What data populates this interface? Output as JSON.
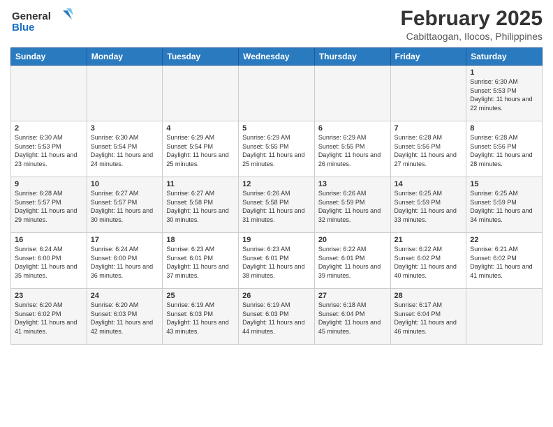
{
  "header": {
    "logo_line1": "General",
    "logo_line2": "Blue",
    "title": "February 2025",
    "subtitle": "Cabittaogan, Ilocos, Philippines"
  },
  "days_of_week": [
    "Sunday",
    "Monday",
    "Tuesday",
    "Wednesday",
    "Thursday",
    "Friday",
    "Saturday"
  ],
  "weeks": [
    [
      {
        "day": "",
        "info": ""
      },
      {
        "day": "",
        "info": ""
      },
      {
        "day": "",
        "info": ""
      },
      {
        "day": "",
        "info": ""
      },
      {
        "day": "",
        "info": ""
      },
      {
        "day": "",
        "info": ""
      },
      {
        "day": "1",
        "info": "Sunrise: 6:30 AM\nSunset: 5:53 PM\nDaylight: 11 hours and 22 minutes."
      }
    ],
    [
      {
        "day": "2",
        "info": "Sunrise: 6:30 AM\nSunset: 5:53 PM\nDaylight: 11 hours and 23 minutes."
      },
      {
        "day": "3",
        "info": "Sunrise: 6:30 AM\nSunset: 5:54 PM\nDaylight: 11 hours and 24 minutes."
      },
      {
        "day": "4",
        "info": "Sunrise: 6:29 AM\nSunset: 5:54 PM\nDaylight: 11 hours and 25 minutes."
      },
      {
        "day": "5",
        "info": "Sunrise: 6:29 AM\nSunset: 5:55 PM\nDaylight: 11 hours and 25 minutes."
      },
      {
        "day": "6",
        "info": "Sunrise: 6:29 AM\nSunset: 5:55 PM\nDaylight: 11 hours and 26 minutes."
      },
      {
        "day": "7",
        "info": "Sunrise: 6:28 AM\nSunset: 5:56 PM\nDaylight: 11 hours and 27 minutes."
      },
      {
        "day": "8",
        "info": "Sunrise: 6:28 AM\nSunset: 5:56 PM\nDaylight: 11 hours and 28 minutes."
      }
    ],
    [
      {
        "day": "9",
        "info": "Sunrise: 6:28 AM\nSunset: 5:57 PM\nDaylight: 11 hours and 29 minutes."
      },
      {
        "day": "10",
        "info": "Sunrise: 6:27 AM\nSunset: 5:57 PM\nDaylight: 11 hours and 30 minutes."
      },
      {
        "day": "11",
        "info": "Sunrise: 6:27 AM\nSunset: 5:58 PM\nDaylight: 11 hours and 30 minutes."
      },
      {
        "day": "12",
        "info": "Sunrise: 6:26 AM\nSunset: 5:58 PM\nDaylight: 11 hours and 31 minutes."
      },
      {
        "day": "13",
        "info": "Sunrise: 6:26 AM\nSunset: 5:59 PM\nDaylight: 11 hours and 32 minutes."
      },
      {
        "day": "14",
        "info": "Sunrise: 6:25 AM\nSunset: 5:59 PM\nDaylight: 11 hours and 33 minutes."
      },
      {
        "day": "15",
        "info": "Sunrise: 6:25 AM\nSunset: 5:59 PM\nDaylight: 11 hours and 34 minutes."
      }
    ],
    [
      {
        "day": "16",
        "info": "Sunrise: 6:24 AM\nSunset: 6:00 PM\nDaylight: 11 hours and 35 minutes."
      },
      {
        "day": "17",
        "info": "Sunrise: 6:24 AM\nSunset: 6:00 PM\nDaylight: 11 hours and 36 minutes."
      },
      {
        "day": "18",
        "info": "Sunrise: 6:23 AM\nSunset: 6:01 PM\nDaylight: 11 hours and 37 minutes."
      },
      {
        "day": "19",
        "info": "Sunrise: 6:23 AM\nSunset: 6:01 PM\nDaylight: 11 hours and 38 minutes."
      },
      {
        "day": "20",
        "info": "Sunrise: 6:22 AM\nSunset: 6:01 PM\nDaylight: 11 hours and 39 minutes."
      },
      {
        "day": "21",
        "info": "Sunrise: 6:22 AM\nSunset: 6:02 PM\nDaylight: 11 hours and 40 minutes."
      },
      {
        "day": "22",
        "info": "Sunrise: 6:21 AM\nSunset: 6:02 PM\nDaylight: 11 hours and 41 minutes."
      }
    ],
    [
      {
        "day": "23",
        "info": "Sunrise: 6:20 AM\nSunset: 6:02 PM\nDaylight: 11 hours and 41 minutes."
      },
      {
        "day": "24",
        "info": "Sunrise: 6:20 AM\nSunset: 6:03 PM\nDaylight: 11 hours and 42 minutes."
      },
      {
        "day": "25",
        "info": "Sunrise: 6:19 AM\nSunset: 6:03 PM\nDaylight: 11 hours and 43 minutes."
      },
      {
        "day": "26",
        "info": "Sunrise: 6:19 AM\nSunset: 6:03 PM\nDaylight: 11 hours and 44 minutes."
      },
      {
        "day": "27",
        "info": "Sunrise: 6:18 AM\nSunset: 6:04 PM\nDaylight: 11 hours and 45 minutes."
      },
      {
        "day": "28",
        "info": "Sunrise: 6:17 AM\nSunset: 6:04 PM\nDaylight: 11 hours and 46 minutes."
      },
      {
        "day": "",
        "info": ""
      }
    ]
  ]
}
